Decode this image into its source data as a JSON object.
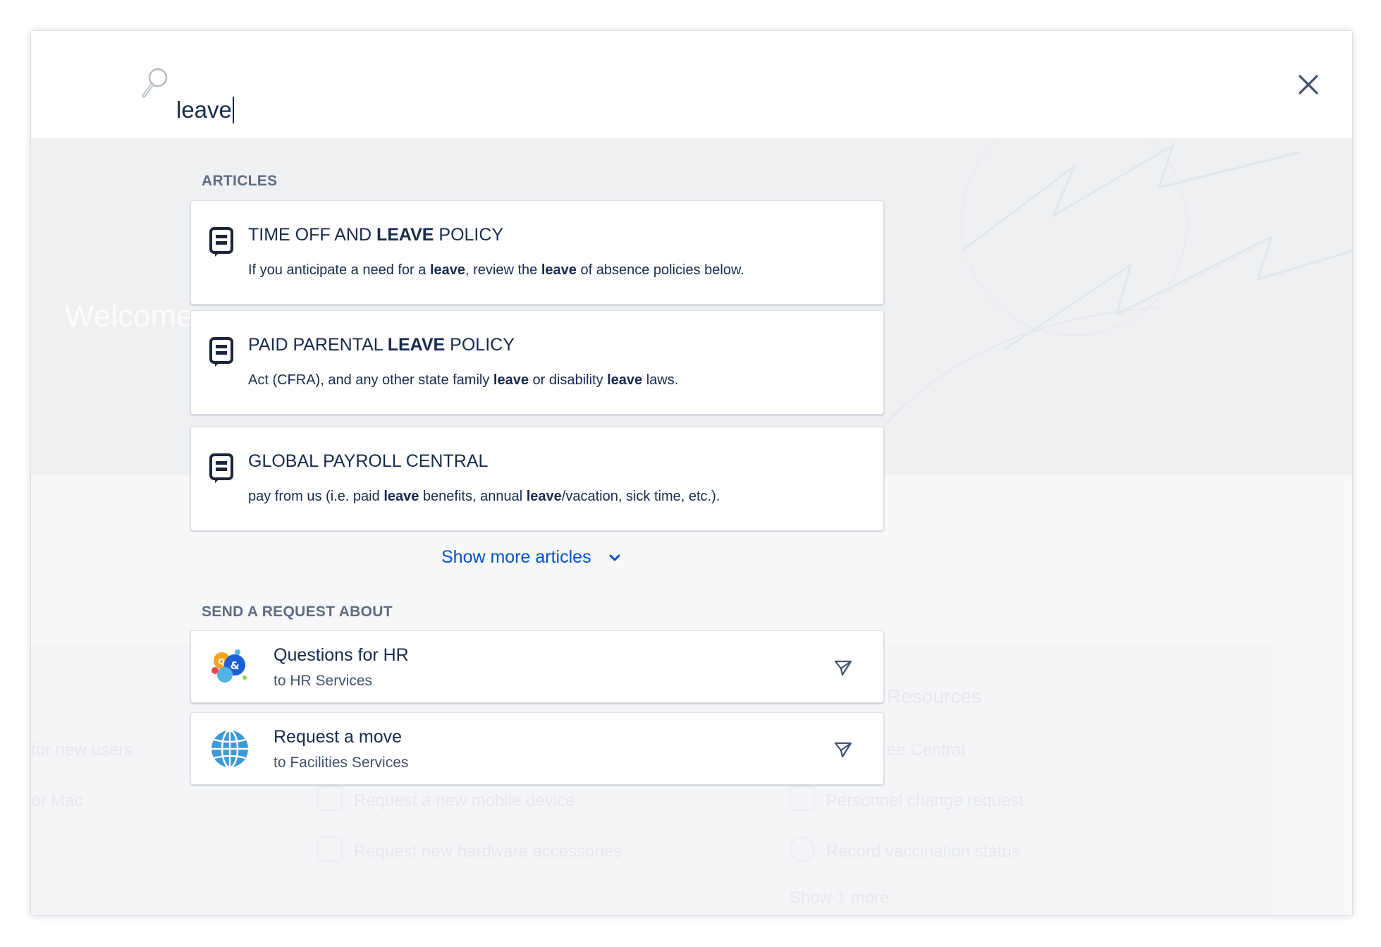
{
  "search": {
    "query": "leave"
  },
  "background": {
    "welcome": "Welcome",
    "col1": [
      "for new users",
      "or Mac"
    ],
    "col2": [
      "Request a new mobile device",
      "Request new hardware accessories"
    ],
    "col3_title": "Resources",
    "col3": [
      "ee Central",
      "Personnel change request",
      "Record vaccination status"
    ],
    "show_more": "Show 1 more"
  },
  "articles": {
    "heading": "ARTICLES",
    "items": [
      {
        "title_parts": [
          "TIME OFF AND ",
          "LEAVE",
          " POLICY"
        ],
        "snippet_parts": [
          "If you anticipate a need for a ",
          "leave",
          ", review the ",
          "leave",
          " of absence policies below."
        ]
      },
      {
        "title_parts": [
          "PAID PARENTAL ",
          "LEAVE",
          " POLICY"
        ],
        "snippet_parts": [
          "Act (CFRA), and any other state family ",
          "leave",
          " or disability ",
          "leave",
          " laws."
        ]
      },
      {
        "title_parts": [
          "GLOBAL PAYROLL CENTRAL"
        ],
        "snippet_parts": [
          "pay from us (i.e. paid ",
          "leave",
          " benefits, annual ",
          "leave",
          "/vacation, sick time, etc.)."
        ]
      }
    ],
    "show_more": "Show more articles"
  },
  "requests": {
    "heading": "SEND A REQUEST ABOUT",
    "items": [
      {
        "title": "Questions for HR",
        "subtitle": "to HR Services",
        "icon": "hr-chat-bubbles-icon"
      },
      {
        "title": "Request a move",
        "subtitle": "to Facilities Services",
        "icon": "globe-icon"
      }
    ]
  },
  "colors": {
    "link": "#0052cc",
    "text": "#172b4d",
    "muted": "#5e6c84"
  }
}
